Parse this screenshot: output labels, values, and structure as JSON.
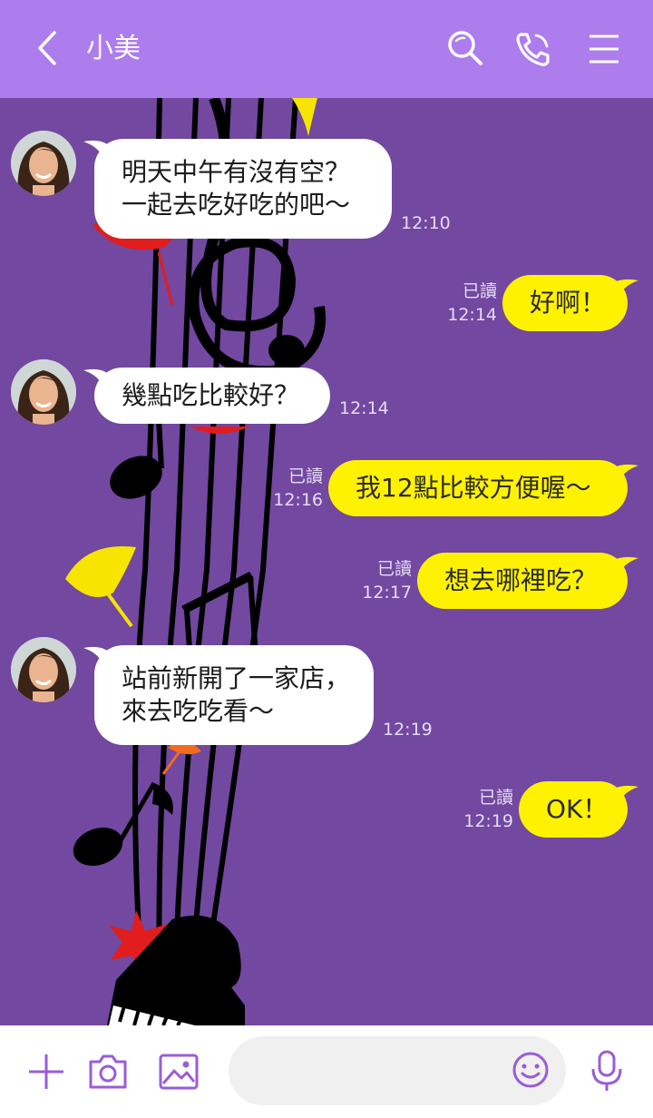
{
  "header": {
    "title": "小美",
    "icons": [
      "back-icon",
      "search-icon",
      "phone-icon",
      "menu-icon"
    ]
  },
  "colors": {
    "header": "#ad7ced",
    "background": "#7248a0",
    "incoming_bubble": "#ffffff",
    "outgoing_bubble": "#fff200"
  },
  "messages": [
    {
      "side": "in",
      "text": "明天中午有沒有空？\n一起去吃好吃的吧～",
      "time": "12:10"
    },
    {
      "side": "out",
      "text": "好啊！",
      "status": "已讀",
      "time": "12:14"
    },
    {
      "side": "in",
      "text": "幾點吃比較好？",
      "time": "12:14"
    },
    {
      "side": "out",
      "text": "我12點比較方便喔～",
      "status": "已讀",
      "time": "12:16"
    },
    {
      "side": "out",
      "text": "想去哪裡吃？",
      "status": "已讀",
      "time": "12:17"
    },
    {
      "side": "in",
      "text": "站前新開了一家店，\n來去吃吃看～",
      "time": "12:19"
    },
    {
      "side": "out",
      "text": "OK！",
      "status": "已讀",
      "time": "12:19"
    }
  ],
  "footer": {
    "input_placeholder": "",
    "icons": [
      "plus-icon",
      "camera-icon",
      "image-icon",
      "emoji-icon",
      "microphone-icon"
    ]
  }
}
